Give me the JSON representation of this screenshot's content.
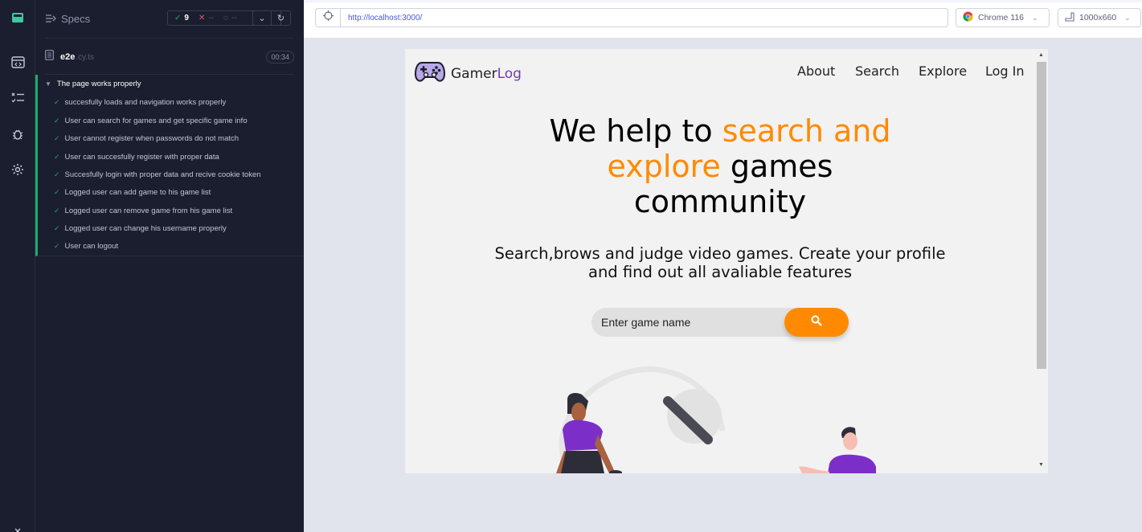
{
  "sidebar": {
    "specs_label": "Specs",
    "stats": {
      "passed": "9",
      "failed": "--",
      "pending": "--"
    }
  },
  "spec_file": {
    "name": "e2e",
    "ext": ".cy.ts",
    "duration": "00:34"
  },
  "suite": {
    "title": "The page works properly",
    "tests": [
      "succesfully loads and navigation works properly",
      "User can search for games and get specific game info",
      "User cannot register when passwords do not match",
      "User can succesfully register with proper data",
      "Succesfully login with proper data and recive cookie token",
      "Logged user can add game to his game list",
      "Logged user can remove game from his game list",
      "Logged user can change his username properly",
      "User can logout"
    ]
  },
  "browser": {
    "url": "http://localhost:3000/",
    "name": "Chrome 116",
    "viewport": "1000x660"
  },
  "app": {
    "logo_main": "Gamer",
    "logo_accent": "Log",
    "nav": [
      "About",
      "Search",
      "Explore",
      "Log In"
    ],
    "hero": {
      "part1": "We help to ",
      "highlight1": "search and",
      "highlight2": "explore",
      "part2": " games",
      "part3": "community"
    },
    "subtitle": "Search,brows and judge video games. Create your profile and find out all avaliable features",
    "search_placeholder": "Enter game name"
  },
  "colors": {
    "accent": "#ff8a00",
    "brand": "#6e3cae",
    "pass": "#1fa971",
    "fail": "#e45770"
  }
}
